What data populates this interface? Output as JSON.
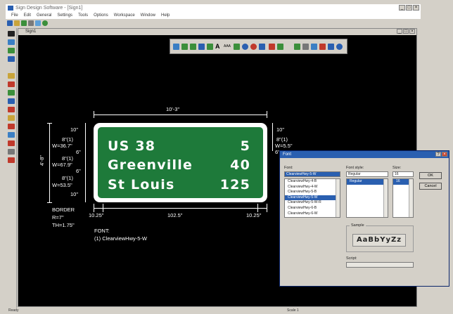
{
  "window": {
    "title": "Sign Design Software - [Sign1]"
  },
  "menu": [
    "File",
    "Edit",
    "General",
    "Settings",
    "Tools",
    "Options",
    "Workspace",
    "Window",
    "Help"
  ],
  "drawing_window": {
    "title": "Sign1"
  },
  "sign": {
    "lines": [
      {
        "destination": "US 38",
        "distance": "5"
      },
      {
        "destination": "Greenville",
        "distance": "40"
      },
      {
        "destination": "St Louis",
        "distance": "125"
      }
    ],
    "background_color": "#1e7a3a"
  },
  "dimensions": {
    "overall_width": "10'-3\"",
    "overall_height": "4'-8\"",
    "left_margin": "10.25\"",
    "center_width": "102.5\"",
    "right_margin": "10.25\"",
    "left_stack": [
      "10\"",
      "8\"(1)",
      "W=36.7\"",
      "6\"",
      "8\"(1)",
      "W=67.9\"",
      "6\"",
      "8\"(1)",
      "W=53.5\"",
      "10\""
    ],
    "right_stack": [
      "10\"",
      "8\"(1)",
      "W=5.5\"",
      "6\""
    ]
  },
  "border_note": [
    "BORDER",
    "R=7\"",
    "TH=1.75\""
  ],
  "font_note": [
    "FONT:",
    "(1) ClearviewHwy-5-W"
  ],
  "font_dialog": {
    "title": "Font",
    "font_label": "Font:",
    "font_value": "ClearviewHwy-5-W",
    "font_list": [
      "ClearviewHwy-4-B",
      "ClearviewHwy-4-W",
      "ClearviewHwy-5-B",
      "ClearviewHwy-5-W",
      "ClearviewHwy-5-W-R",
      "ClearviewHwy-6-B",
      "ClearviewHwy-6-W"
    ],
    "font_selected_index": 3,
    "style_label": "Font style:",
    "style_value": "Regular",
    "style_list": [
      "Regular"
    ],
    "size_label": "Size:",
    "size_value": "16",
    "size_list": [
      "16"
    ],
    "ok_label": "OK",
    "cancel_label": "Cancel",
    "sample_label": "Sample",
    "sample_text": "AaBbYyZz",
    "script_label": "Script:",
    "script_value": ""
  },
  "status": {
    "left_text": "Ready",
    "right_text": "Scale 1"
  }
}
